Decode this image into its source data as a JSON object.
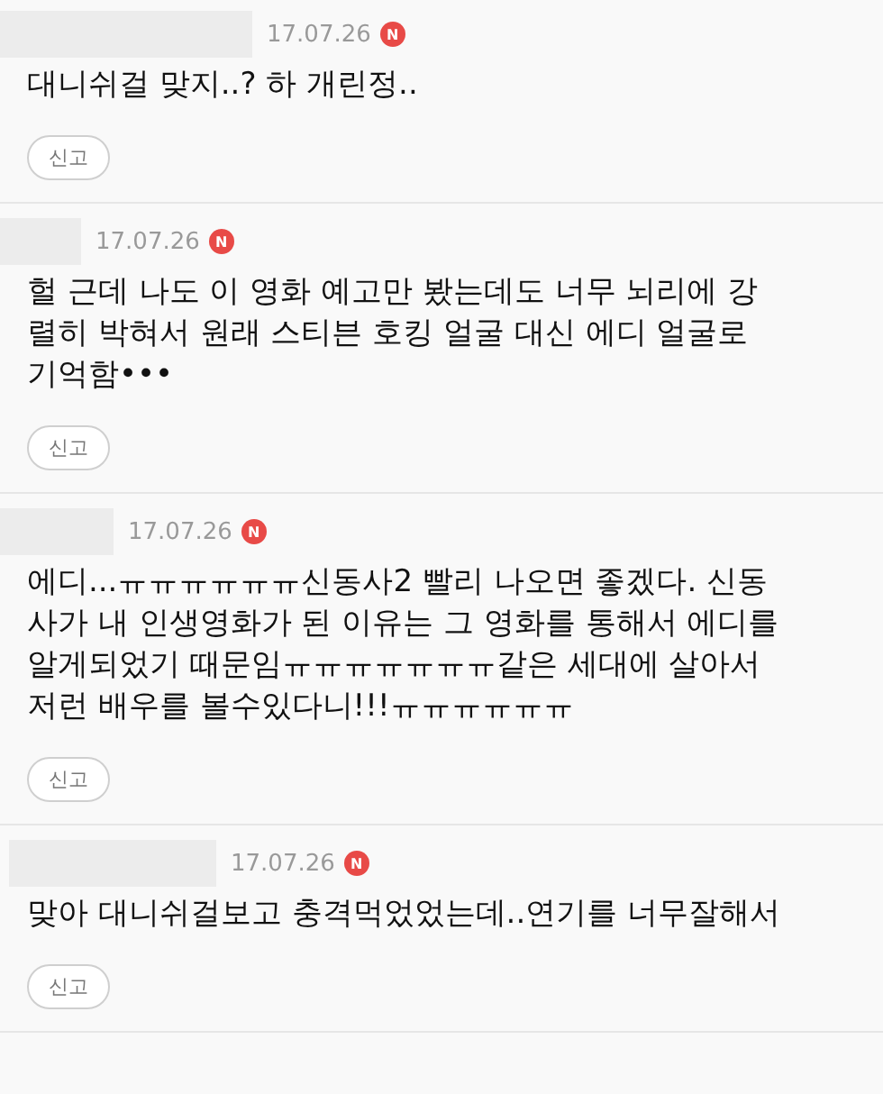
{
  "comments": [
    {
      "date": "17.07.26",
      "new_badge": "N",
      "lines": [
        "대니쉬걸 맞지..? 하 개린정.."
      ],
      "report_button": "신고"
    },
    {
      "date": "17.07.26",
      "new_badge": "N",
      "lines": [
        "헐 근데 나도 이 영화 예고만 봤는데도 너무 뇌리에 강",
        "렬히 박혀서 원래 스티븐 호킹 얼굴 대신 에디 얼굴로",
        "기억함•••"
      ],
      "report_button": "신고"
    },
    {
      "date": "17.07.26",
      "new_badge": "N",
      "lines": [
        "에디...ㅠㅠㅠㅠㅠㅠ신동사2 빨리 나오면 좋겠다. 신동",
        "사가 내 인생영화가 된 이유는 그 영화를 통해서 에디를",
        "알게되었기 때문임ㅠㅠㅠㅠㅠㅠㅠ같은 세대에 살아서",
        "저런 배우를 볼수있다니!!!ㅠㅠㅠㅠㅠㅠ"
      ],
      "report_button": "신고"
    },
    {
      "date": "17.07.26",
      "new_badge": "N",
      "lines": [
        "맞아 대니쉬걸보고 충격먹었었는데..연기를 너무잘해서"
      ],
      "report_button": "신고"
    }
  ]
}
